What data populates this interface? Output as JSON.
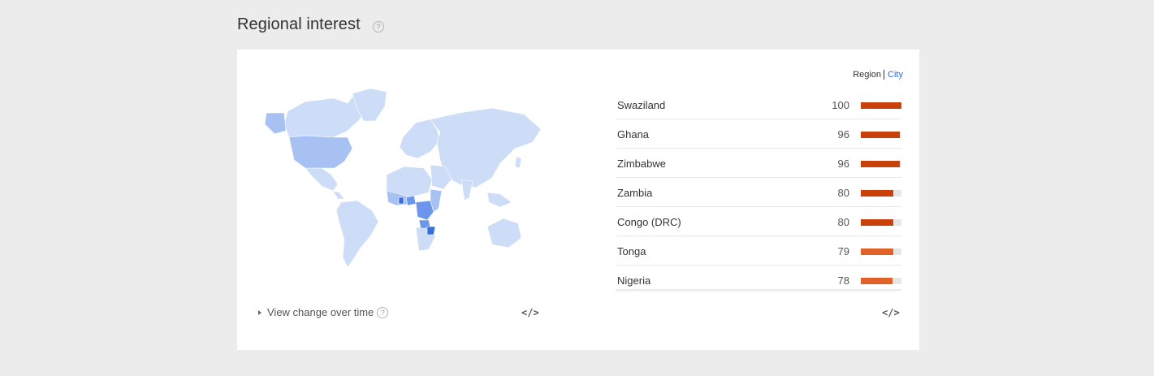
{
  "section": {
    "title": "Regional interest",
    "help": "?"
  },
  "toggle": {
    "region": "Region",
    "city": "City"
  },
  "regions": [
    {
      "name": "Swaziland",
      "value": "100",
      "level": 1.0
    },
    {
      "name": "Ghana",
      "value": "96",
      "level": 0.96
    },
    {
      "name": "Zimbabwe",
      "value": "96",
      "level": 0.96
    },
    {
      "name": "Zambia",
      "value": "80",
      "level": 0.8
    },
    {
      "name": "Congo (DRC)",
      "value": "80",
      "level": 0.8
    },
    {
      "name": "Tonga",
      "value": "79",
      "level": 0.79
    },
    {
      "name": "Nigeria",
      "value": "78",
      "level": 0.78
    }
  ],
  "map": {
    "legend_help": "?"
  },
  "footer": {
    "view_change": "View change over time",
    "help": "?",
    "embed": "</>"
  },
  "colors": {
    "bar_dark": "#c8410b",
    "bar_light": "#e0622a",
    "map_base": "#cddcf7",
    "map_mid": "#a7c2f2",
    "map_high": "#6b96eb",
    "map_top": "#3a6fdb"
  }
}
